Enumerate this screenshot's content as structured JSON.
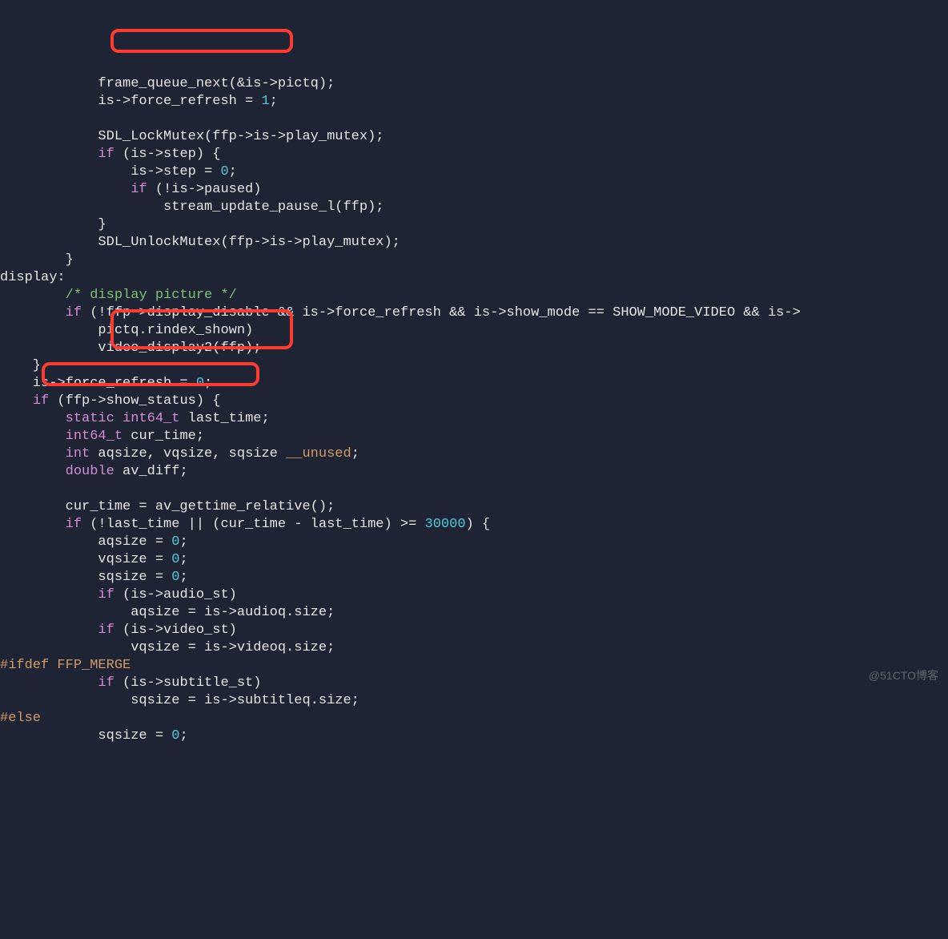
{
  "code": {
    "l01a": "            frame_queue_next(&is->pictq);",
    "l02a": "            is->force_refresh = ",
    "l02n": "1",
    "l02b": ";",
    "l03": "",
    "l04": "            SDL_LockMutex(ffp->is->play_mutex);",
    "l05a": "            ",
    "l05kw": "if",
    "l05b": " (is->step) {",
    "l06a": "                is->step = ",
    "l06n": "0",
    "l06b": ";",
    "l07a": "                ",
    "l07kw": "if",
    "l07b": " (!is->paused)",
    "l08": "                    stream_update_pause_l(ffp);",
    "l09": "            }",
    "l10": "            SDL_UnlockMutex(ffp->is->play_mutex);",
    "l11": "        }",
    "l12": "display:",
    "l13a": "        ",
    "l13c": "/* display picture */",
    "l14a": "        ",
    "l14kw": "if",
    "l14b": " (!ffp->display_disable && is->force_refresh && is->show_mode == SHOW_MODE_VIDEO && is->",
    "l15": "            pictq.rindex_shown)",
    "l16": "            video_display2(ffp);",
    "l17": "    }",
    "l18a": "    is->force_refresh = ",
    "l18n": "0",
    "l18b": ";",
    "l19a": "    ",
    "l19kw": "if",
    "l19b": " (ffp->show_status) {",
    "l20a": "        ",
    "l20kw": "static",
    "l20b": " ",
    "l20t": "int64_t",
    "l20c": " last_time;",
    "l21a": "        ",
    "l21t": "int64_t",
    "l21b": " cur_time;",
    "l22a": "        ",
    "l22t": "int",
    "l22b": " aqsize, vqsize, sqsize ",
    "l22u": "__unused",
    "l22c": ";",
    "l23a": "        ",
    "l23t": "double",
    "l23b": " av_diff;",
    "l24": "",
    "l25": "        cur_time = av_gettime_relative();",
    "l26a": "        ",
    "l26kw": "if",
    "l26b": " (!last_time || (cur_time - last_time) >= ",
    "l26n": "30000",
    "l26c": ") {",
    "l27a": "            aqsize = ",
    "l27n": "0",
    "l27b": ";",
    "l28a": "            vqsize = ",
    "l28n": "0",
    "l28b": ";",
    "l29a": "            sqsize = ",
    "l29n": "0",
    "l29b": ";",
    "l30a": "            ",
    "l30kw": "if",
    "l30b": " (is->audio_st)",
    "l31": "                aqsize = is->audioq.size;",
    "l32a": "            ",
    "l32kw": "if",
    "l32b": " (is->video_st)",
    "l33": "                vqsize = is->videoq.size;",
    "l34": "#ifdef FFP_MERGE",
    "l35a": "            ",
    "l35kw": "if",
    "l35b": " (is->subtitle_st)",
    "l36": "                sqsize = is->subtitleq.size;",
    "l37": "#else",
    "l38a": "            sqsize = ",
    "l38n": "0",
    "l38b": ";"
  },
  "watermark": "@51CTO博客"
}
